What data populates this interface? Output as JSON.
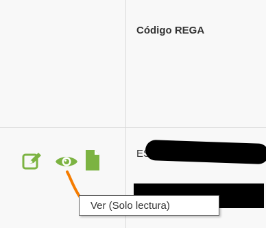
{
  "table": {
    "header": {
      "actions_label": "",
      "rega_label": "Código REGA"
    },
    "row": {
      "rega_value": "ES",
      "actions": [
        {
          "icon": "edit-icon",
          "color": "#7cb342"
        },
        {
          "icon": "eye-icon",
          "color": "#7cb342"
        },
        {
          "icon": "file-icon",
          "color": "#7cb342"
        }
      ]
    }
  },
  "tooltip": {
    "text": "Ver (Solo lectura)"
  },
  "colors": {
    "accent": "#7cb342",
    "annotation": "#f57c00",
    "border": "#d9d9d9"
  }
}
